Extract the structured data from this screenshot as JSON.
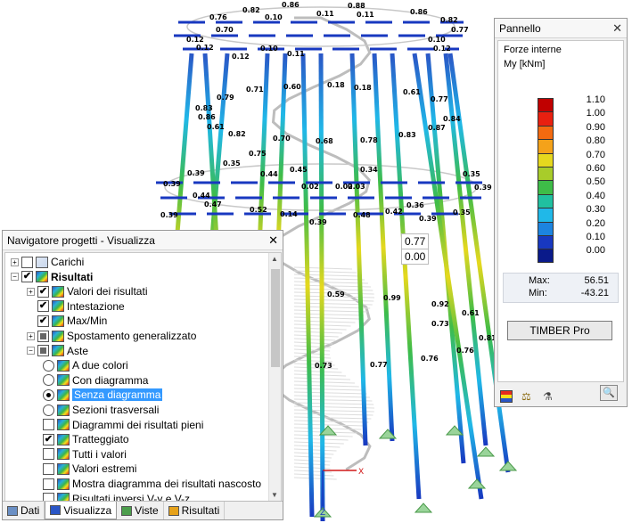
{
  "panel": {
    "title": "Pannello",
    "close": "✕",
    "subtitle": "Forze interne",
    "quantity": "My [kNm]",
    "scale_ticks": [
      "1.10",
      "1.00",
      "0.90",
      "0.80",
      "0.70",
      "0.60",
      "0.50",
      "0.40",
      "0.30",
      "0.20",
      "0.10",
      "0.00"
    ],
    "scale_colors": [
      "#c00000",
      "#e82010",
      "#f36a10",
      "#f4a21a",
      "#e6d81e",
      "#a8cc2a",
      "#3ebc48",
      "#20c0a0",
      "#20b8e8",
      "#1c84e0",
      "#1838c0",
      "#0a1a8a"
    ],
    "max_label": "Max:",
    "max_value": "56.51",
    "min_label": "Min:",
    "min_value": "-43.21",
    "button": "TIMBER Pro"
  },
  "navigator": {
    "title": "Navigatore progetti - Visualizza",
    "close": "✕",
    "items": [
      {
        "label": "Carichi",
        "check": "none",
        "exp": "+",
        "icon": "load-icon"
      },
      {
        "label": "Risultati",
        "check": "checked",
        "exp": "-",
        "icon": "results-icon"
      },
      {
        "label": "Valori dei risultati",
        "check": "checked",
        "exp": "+",
        "icon": "values-icon"
      },
      {
        "label": "Intestazione",
        "check": "checked",
        "exp": "",
        "icon": "header-icon"
      },
      {
        "label": "Max/Min",
        "check": "checked",
        "exp": "",
        "icon": "maxmin-icon"
      },
      {
        "label": "Spostamento generalizzato",
        "check": "partial",
        "exp": "+",
        "icon": "displacement-icon"
      },
      {
        "label": "Aste",
        "check": "partial",
        "exp": "-",
        "icon": "members-icon"
      },
      {
        "label": "A due colori",
        "radio": "off",
        "icon": "two-colors-icon"
      },
      {
        "label": "Con diagramma",
        "radio": "off",
        "icon": "with-diagram-icon"
      },
      {
        "label": "Senza diagramma",
        "radio": "on",
        "icon": "without-diagram-icon"
      },
      {
        "label": "Sezioni trasversali",
        "radio": "off",
        "icon": "cross-sections-icon"
      },
      {
        "label": "Diagrammi dei risultati pieni",
        "check": "none",
        "icon": "filled-diagrams-icon"
      },
      {
        "label": "Tratteggiato",
        "check": "checked",
        "icon": "hatched-icon"
      },
      {
        "label": "Tutti i valori",
        "check": "none",
        "icon": "all-values-icon"
      },
      {
        "label": "Valori estremi",
        "check": "none",
        "icon": "extreme-values-icon"
      },
      {
        "label": "Mostra diagramma dei risultati nascosto",
        "check": "none",
        "icon": "hidden-diagram-icon"
      },
      {
        "label": "Risultati inversi V-y e V-z",
        "check": "none",
        "icon": "inverse-results-icon"
      }
    ],
    "tabs": [
      {
        "label": "Dati",
        "icon": "data-icon"
      },
      {
        "label": "Visualizza",
        "icon": "display-icon"
      },
      {
        "label": "Viste",
        "icon": "views-icon"
      },
      {
        "label": "Risultati",
        "icon": "results-tab-icon"
      }
    ]
  },
  "viewport": {
    "tag_a": "0.77",
    "tag_b": "0.00",
    "axis_x": "X",
    "axis_z": "Z"
  }
}
